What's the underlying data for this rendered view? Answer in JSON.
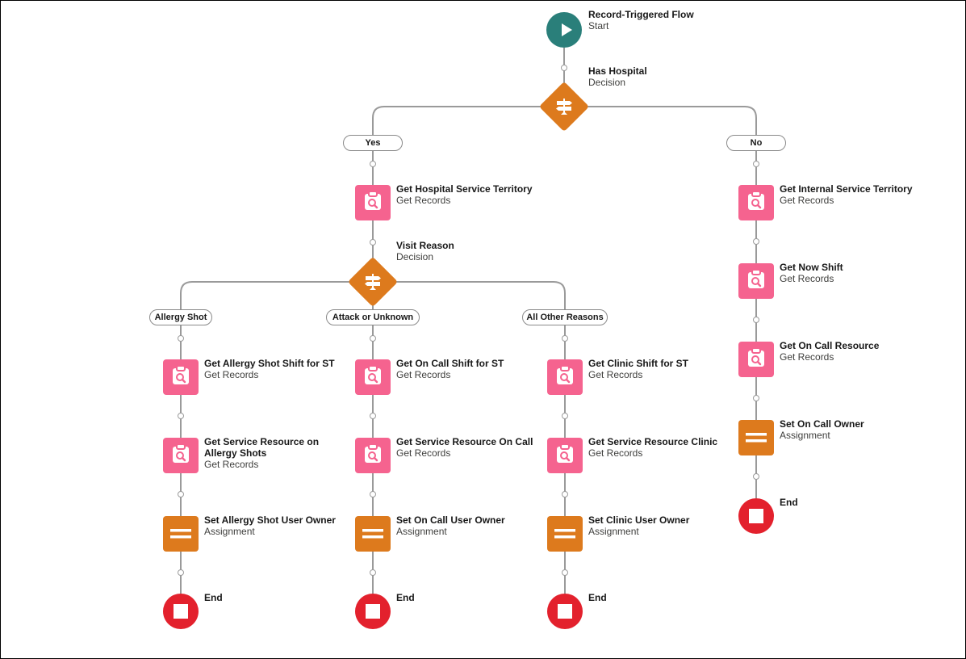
{
  "colors": {
    "start": "#2a7f7a",
    "decision": "#dd7a1d",
    "get_records": "#f5638f",
    "assignment": "#dd7a1d",
    "end": "#e3212d",
    "connector": "#9a9a9a"
  },
  "start": {
    "title": "Record-Triggered Flow",
    "type": "Start",
    "icon": "play-icon"
  },
  "has_hospital": {
    "title": "Has Hospital",
    "type": "Decision",
    "icon": "decision-signpost-icon",
    "outcomes": [
      "Yes",
      "No"
    ]
  },
  "yes_branch": {
    "get_hospital_territory": {
      "title": "Get Hospital Service Territory",
      "type": "Get Records"
    },
    "visit_reason": {
      "title": "Visit Reason",
      "type": "Decision",
      "outcomes": [
        "Allergy Shot",
        "Attack or Unknown",
        "All Other Reasons"
      ]
    },
    "allergy": [
      {
        "title": "Get Allergy Shot Shift for ST",
        "type": "Get Records",
        "kind": "get"
      },
      {
        "title": "Get Service Resource on Allergy Shots",
        "type": "Get Records",
        "kind": "get"
      },
      {
        "title": "Set Allergy Shot User Owner",
        "type": "Assignment",
        "kind": "assign"
      },
      {
        "title": "End",
        "type": "",
        "kind": "end"
      }
    ],
    "attack": [
      {
        "title": "Get On Call Shift for ST",
        "type": "Get Records",
        "kind": "get"
      },
      {
        "title": "Get Service Resource On Call",
        "type": "Get Records",
        "kind": "get"
      },
      {
        "title": "Set On Call User Owner",
        "type": "Assignment",
        "kind": "assign"
      },
      {
        "title": "End",
        "type": "",
        "kind": "end"
      }
    ],
    "other": [
      {
        "title": "Get Clinic Shift for ST",
        "type": "Get Records",
        "kind": "get"
      },
      {
        "title": "Get Service Resource Clinic",
        "type": "Get Records",
        "kind": "get"
      },
      {
        "title": "Set Clinic User Owner",
        "type": "Assignment",
        "kind": "assign"
      },
      {
        "title": "End",
        "type": "",
        "kind": "end"
      }
    ]
  },
  "no_branch": [
    {
      "title": "Get Internal Service Territory",
      "type": "Get Records",
      "kind": "get"
    },
    {
      "title": "Get Now Shift",
      "type": "Get Records",
      "kind": "get"
    },
    {
      "title": "Get On Call Resource",
      "type": "Get Records",
      "kind": "get"
    },
    {
      "title": "Set On Call Owner",
      "type": "Assignment",
      "kind": "assign"
    },
    {
      "title": "End",
      "type": "",
      "kind": "end"
    }
  ]
}
